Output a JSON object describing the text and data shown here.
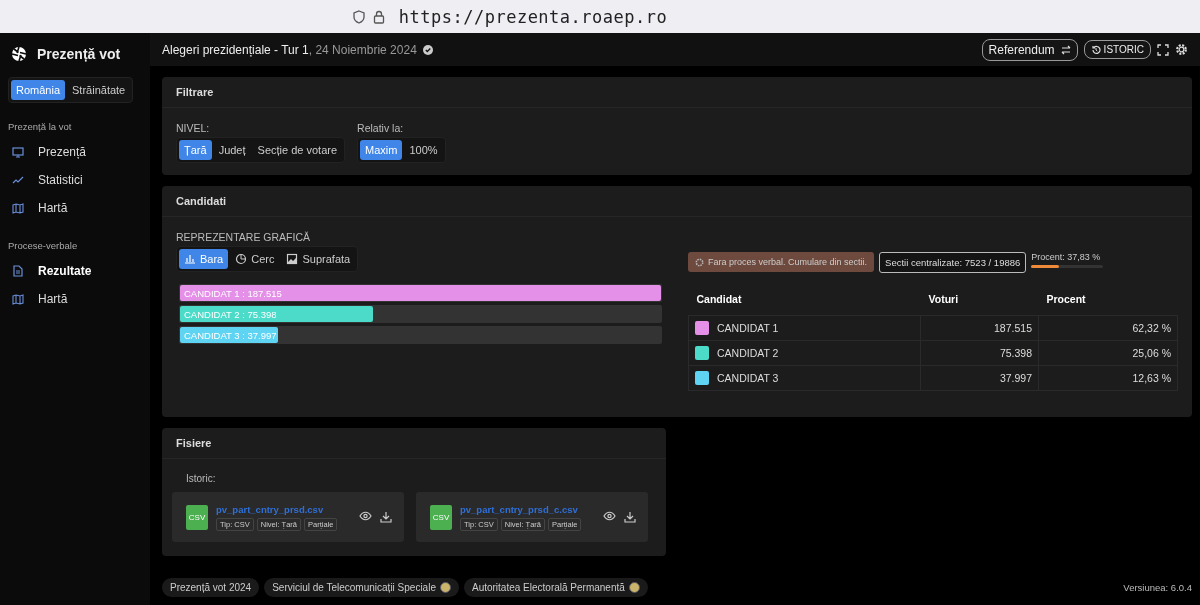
{
  "browser": {
    "url": "https://prezenta.roaep.ro"
  },
  "sidebar": {
    "title": "Prezență vot",
    "scope_tabs": [
      {
        "label": "România",
        "selected": true
      },
      {
        "label": "Străinătate",
        "selected": false
      }
    ],
    "sections": [
      {
        "label": "Prezență la vot",
        "items": [
          {
            "label": "Prezență",
            "kind": "monitor",
            "selected": false
          },
          {
            "label": "Statistici",
            "kind": "trend",
            "selected": false
          },
          {
            "label": "Hartă",
            "kind": "map",
            "selected": false
          }
        ]
      },
      {
        "label": "Procese-verbale",
        "items": [
          {
            "label": "Rezultate",
            "kind": "doc",
            "selected": true
          },
          {
            "label": "Hartă",
            "kind": "map",
            "selected": false
          }
        ]
      }
    ]
  },
  "header": {
    "title": "Alegeri prezidențiale - Tur 1",
    "date": ", 24 Noiembrie 2024",
    "buttons": [
      {
        "label": "Referendum",
        "kind": "switch"
      },
      {
        "label": "ISTORIC",
        "kind": "history"
      }
    ]
  },
  "filter_panel": {
    "title": "Filtrare",
    "groups": [
      {
        "label": "NIVEL:",
        "options": [
          {
            "label": "Țară",
            "selected": true
          },
          {
            "label": "Județ",
            "selected": false
          },
          {
            "label": "Secție de votare",
            "selected": false
          }
        ]
      },
      {
        "label": "Relativ la:",
        "options": [
          {
            "label": "Maxim",
            "selected": true
          },
          {
            "label": "100%",
            "selected": false
          }
        ]
      }
    ]
  },
  "candidates_panel": {
    "title": "Candidati",
    "chart_label": "REPREZENTARE GRAFICĂ",
    "chart_tabs": [
      {
        "label": "Bara",
        "kind": "bar",
        "selected": true
      },
      {
        "label": "Cerc",
        "kind": "pie",
        "selected": false
      },
      {
        "label": "Suprafata",
        "kind": "area",
        "selected": false
      }
    ],
    "bars": [
      {
        "label": "CANDIDAT 1 : 187.515",
        "level": 1,
        "color": "#e590e8"
      },
      {
        "label": "CANDIDAT 2 : 75.398",
        "level": 0.402,
        "color": "#4ddbc9"
      },
      {
        "label": "CANDIDAT 3 : 37.997",
        "level": 0.203,
        "color": "#5fd4f2"
      }
    ],
    "notice": "Fara proces verbal. Cumulare din sectii.",
    "sections_count": "Sectii centralizate: 7523 / 19886",
    "percent": {
      "label": "Procent: 37,83 %",
      "level": 0.3783
    },
    "table": {
      "columns": [
        "Candidat",
        "Voturi",
        "Procent"
      ],
      "rows": [
        {
          "name": "CANDIDAT 1",
          "color": "#e590e8",
          "votes": "187.515",
          "percent": "62,32 %"
        },
        {
          "name": "CANDIDAT 2",
          "color": "#4ddbc9",
          "votes": "75.398",
          "percent": "25,06 %"
        },
        {
          "name": "CANDIDAT 3",
          "color": "#5fd4f2",
          "votes": "37.997",
          "percent": "12,63 %"
        }
      ]
    }
  },
  "files_panel": {
    "title": "Fisiere",
    "subtitle": "Istoric:",
    "files": [
      {
        "badge": "CSV",
        "name": "pv_part_cntry_prsd.csv",
        "tags": [
          "Tip: CSV",
          "Nivel: Țară",
          "Parțiale"
        ]
      },
      {
        "badge": "CSV",
        "name": "pv_part_cntry_prsd_c.csv",
        "tags": [
          "Tip: CSV",
          "Nivel: Țară",
          "Parțiale"
        ]
      }
    ]
  },
  "footer": {
    "links": [
      {
        "label": "Prezență vot 2024",
        "kind": "plain"
      },
      {
        "label": "Serviciul de Telecomunicații Speciale",
        "kind": "emblem"
      },
      {
        "label": "Autoritatea Electorală Permanentă",
        "kind": "emblem"
      }
    ],
    "version": "Versiunea: 6.0.4"
  }
}
